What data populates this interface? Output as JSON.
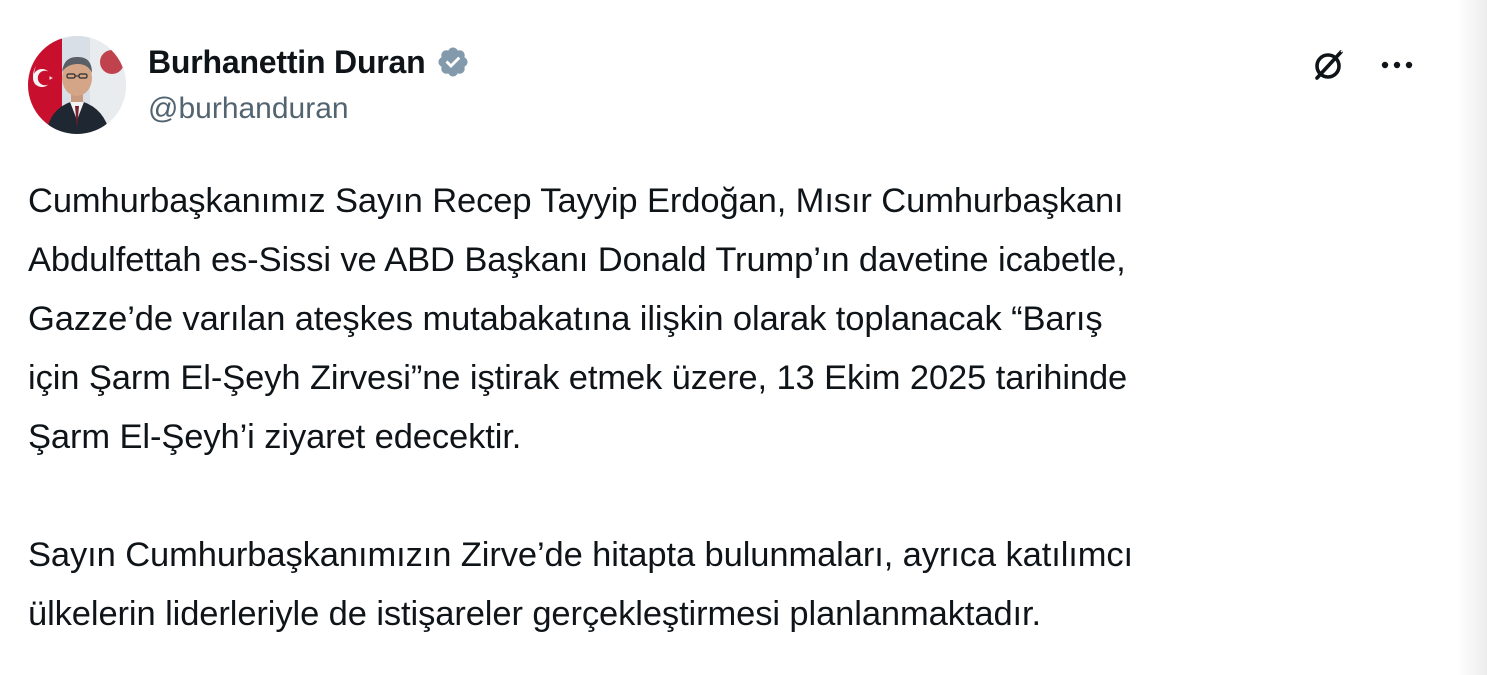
{
  "author": {
    "display_name": "Burhanettin Duran",
    "handle": "@burhanduran",
    "verified": true
  },
  "icons": {
    "verified": "verified-badge-icon",
    "grok": "grok-icon",
    "more": "more-options-icon"
  },
  "colors": {
    "text_primary": "#0f1419",
    "text_secondary": "#536471",
    "badge": "#829aab"
  },
  "tweet": {
    "paragraphs": [
      {
        "lines": [
          "Cumhurbaşkanımız Sayın Recep Tayyip Erdoğan, Mısır Cumhurbaşkanı",
          "Abdulfettah es-Sissi ve ABD Başkanı Donald Trump’ın davetine icabetle,",
          "Gazze’de varılan ateşkes mutabakatına ilişkin olarak toplanacak “Barış",
          "için Şarm El-Şeyh Zirvesi”ne iştirak etmek üzere, 13 Ekim 2025 tarihinde",
          "Şarm El-Şeyh’i ziyaret edecektir."
        ]
      },
      {
        "lines": [
          "Sayın Cumhurbaşkanımızın Zirve’de hitapta bulunmaları, ayrıca katılımcı",
          "ülkelerin liderleriyle de istişareler gerçekleştirmesi planlanmaktadır."
        ]
      }
    ]
  }
}
